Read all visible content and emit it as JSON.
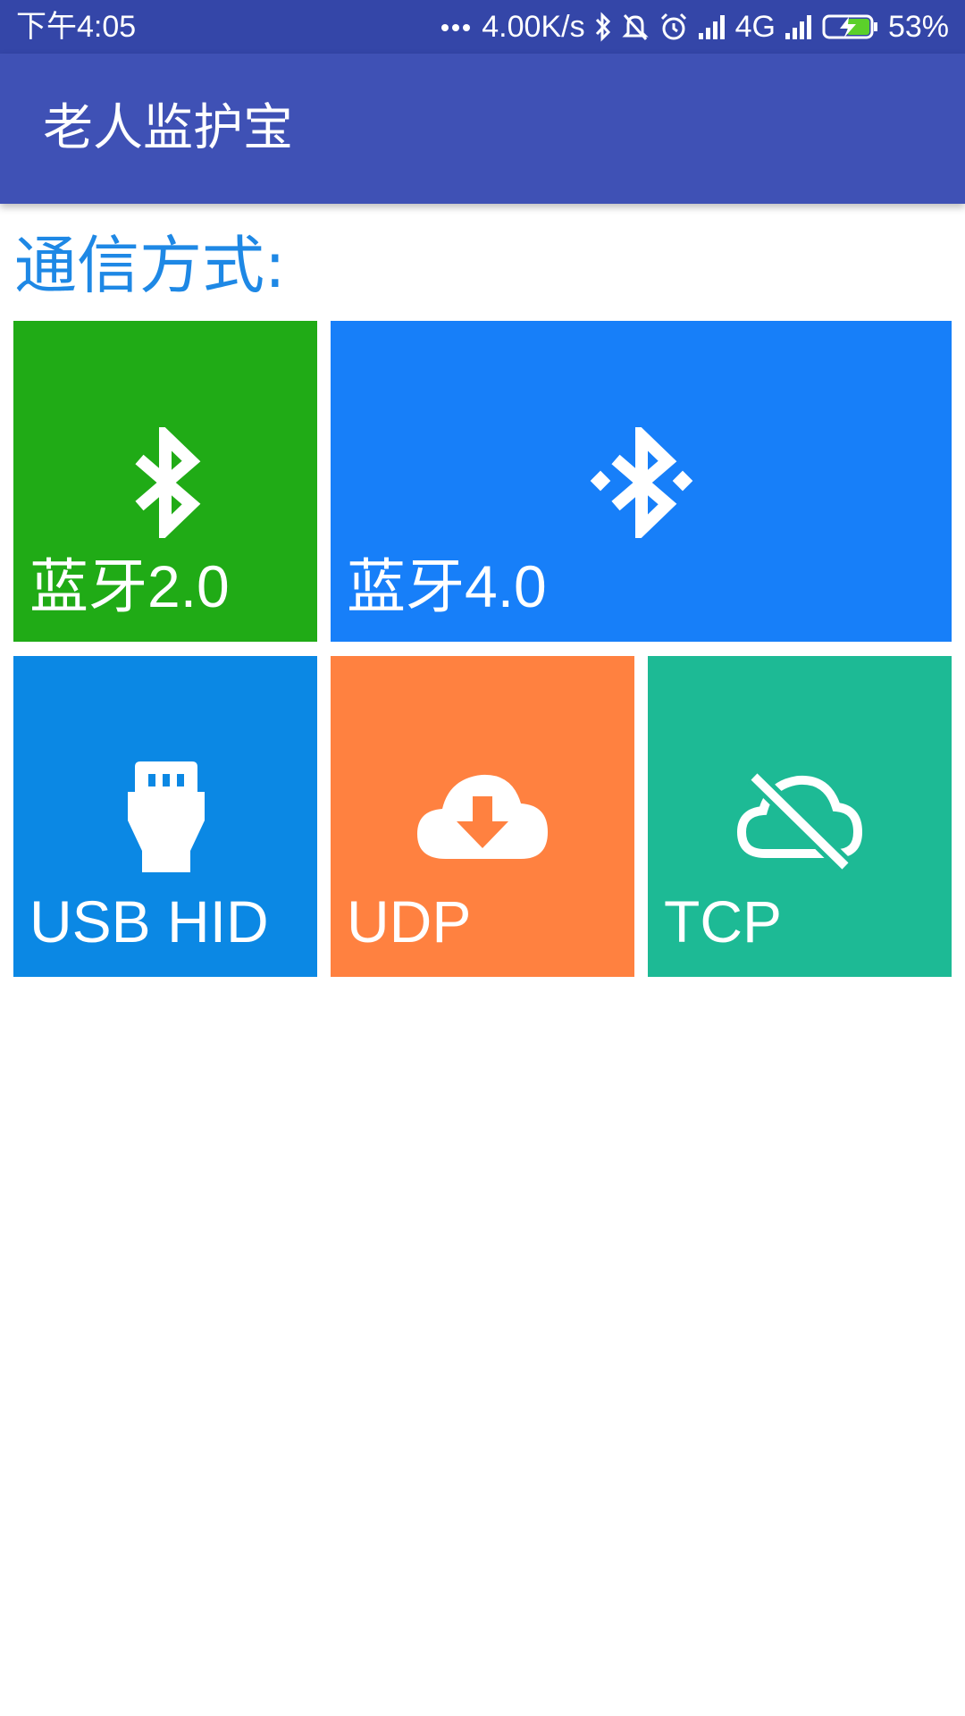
{
  "status_bar": {
    "time": "下午4:05",
    "net_speed": "4.00K/s",
    "network": "4G",
    "battery": "53%"
  },
  "app_bar": {
    "title": "老人监护宝"
  },
  "main": {
    "heading": "通信方式:",
    "tiles": [
      {
        "label": "蓝牙2.0",
        "color": "#20ab16",
        "icon": "bluetooth-icon"
      },
      {
        "label": "蓝牙4.0",
        "color": "#177ff9",
        "icon": "bluetooth-searching-icon"
      },
      {
        "label": "USB HID",
        "color": "#0b88e4",
        "icon": "usb-icon"
      },
      {
        "label": "UDP",
        "color": "#ff8140",
        "icon": "cloud-download-icon"
      },
      {
        "label": "TCP",
        "color": "#1dba95",
        "icon": "cloud-off-icon"
      }
    ]
  },
  "colors": {
    "status_bar": "#3446a8",
    "app_bar": "#3f51b5",
    "heading": "#1e88e5"
  }
}
